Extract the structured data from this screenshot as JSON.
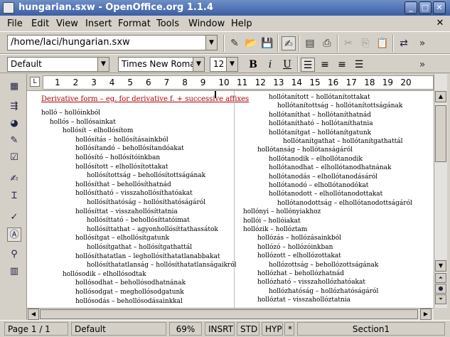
{
  "window": {
    "title": "hungarian.sxw - OpenOffice.org 1.1.4",
    "minimize_label": "_",
    "maximize_label": "□",
    "close_label": "✕"
  },
  "menubar": {
    "items": [
      "File",
      "Edit",
      "View",
      "Insert",
      "Format",
      "Tools",
      "Window",
      "Help"
    ],
    "close_doc_label": "✕"
  },
  "toolbar": {
    "url_value": "/home/laci/hungarian.sxw"
  },
  "formatbar": {
    "paragraph_style": "Default",
    "font_name": "Times New Roman",
    "font_size": "12",
    "bold_label": "B",
    "italic_label": "i",
    "underline_label": "U"
  },
  "ruler": {
    "numbers": [
      "1",
      "2",
      "3",
      "4",
      "5",
      "6",
      "7",
      "8",
      "9",
      "10",
      "11",
      "12",
      "13",
      "14",
      "15",
      "16",
      "17",
      "18",
      "19",
      "20"
    ]
  },
  "document": {
    "heading": "Derivative form – eg. for derivative f. + successive affixes",
    "left_column": [
      "holló – hollóinkból",
      "hollós – hollósainkat",
      "hollósít – elhollósítom",
      "hollósítás – hollósításainkból",
      "hollósítandó – behollósítandóakat",
      "hollósító – hollósítóinkban",
      "hollósított – elhollósítottakat",
      "hollósítottság – behollósítottságának",
      "hollósíthat – behollósíthatnád",
      "hollósítható – visszahollósíthatóakat",
      "hollósíthatóság – hollósíthatóságáról",
      "hollósíttat – visszahollósíttatnia",
      "hollósíttató – behollósíttatóimat",
      "hollósíttathat – agyonhollósíttathassátok",
      "hollósítgat – elhollósítgatunk",
      "hollósítgathat – hollósítgathattál",
      "hollósíthatatlan – leghollósíthatatlanabbakat",
      "hollósíthatatlanság – hollósíthatatlanságaikról",
      "hollósodik – elhollósodtak",
      "hollósodhat – behollósodhatnának",
      "hollósodgat – meghollósodgatunk",
      "hollósodás – behollósodásainkkal"
    ],
    "right_column": [
      "hollótanított – hollótanítottakat",
      "hollótanítottság – hollótanítottságának",
      "hollótaníthat – hollótaníthatnád",
      "hollótanítható – hollótaníthatnia",
      "hollótanítgat – hollótanítgatunk",
      "hollótanítgathat – hollótanítgathattál",
      "hollótanság – hollótanságáról",
      "hollótanodik – elhollótanodik",
      "hollótanodhat – elhollótanodhatnának",
      "hollótanodás – elhollótanodásáról",
      "hollótanodó – elhollótanodókat",
      "hollótanodott – elhollótanodottakat",
      "hollótanodottság – elhollótanodottságáról",
      "hollónyi – hollónyiakhoz",
      "hollói – hollóiakat",
      "hollózik – hollóztam",
      "hollózás – hollózásainkból",
      "hollózó – hollózóinkban",
      "hollózott – elhollózottakat",
      "hollózottság – behollózottságának",
      "hollózhat – behollózhatnád",
      "hollózható – visszahollózhatóakat",
      "hollózhatóság – hollózhatóságáról",
      "hollóztat – visszahollóztatnia"
    ]
  },
  "statusbar": {
    "page": "Page 1 / 1",
    "style": "Default",
    "zoom": "69%",
    "insert_mode": "INSRT",
    "selection_mode": "STD",
    "hyphen": "HYP",
    "modified": "*",
    "section": "Section1"
  }
}
